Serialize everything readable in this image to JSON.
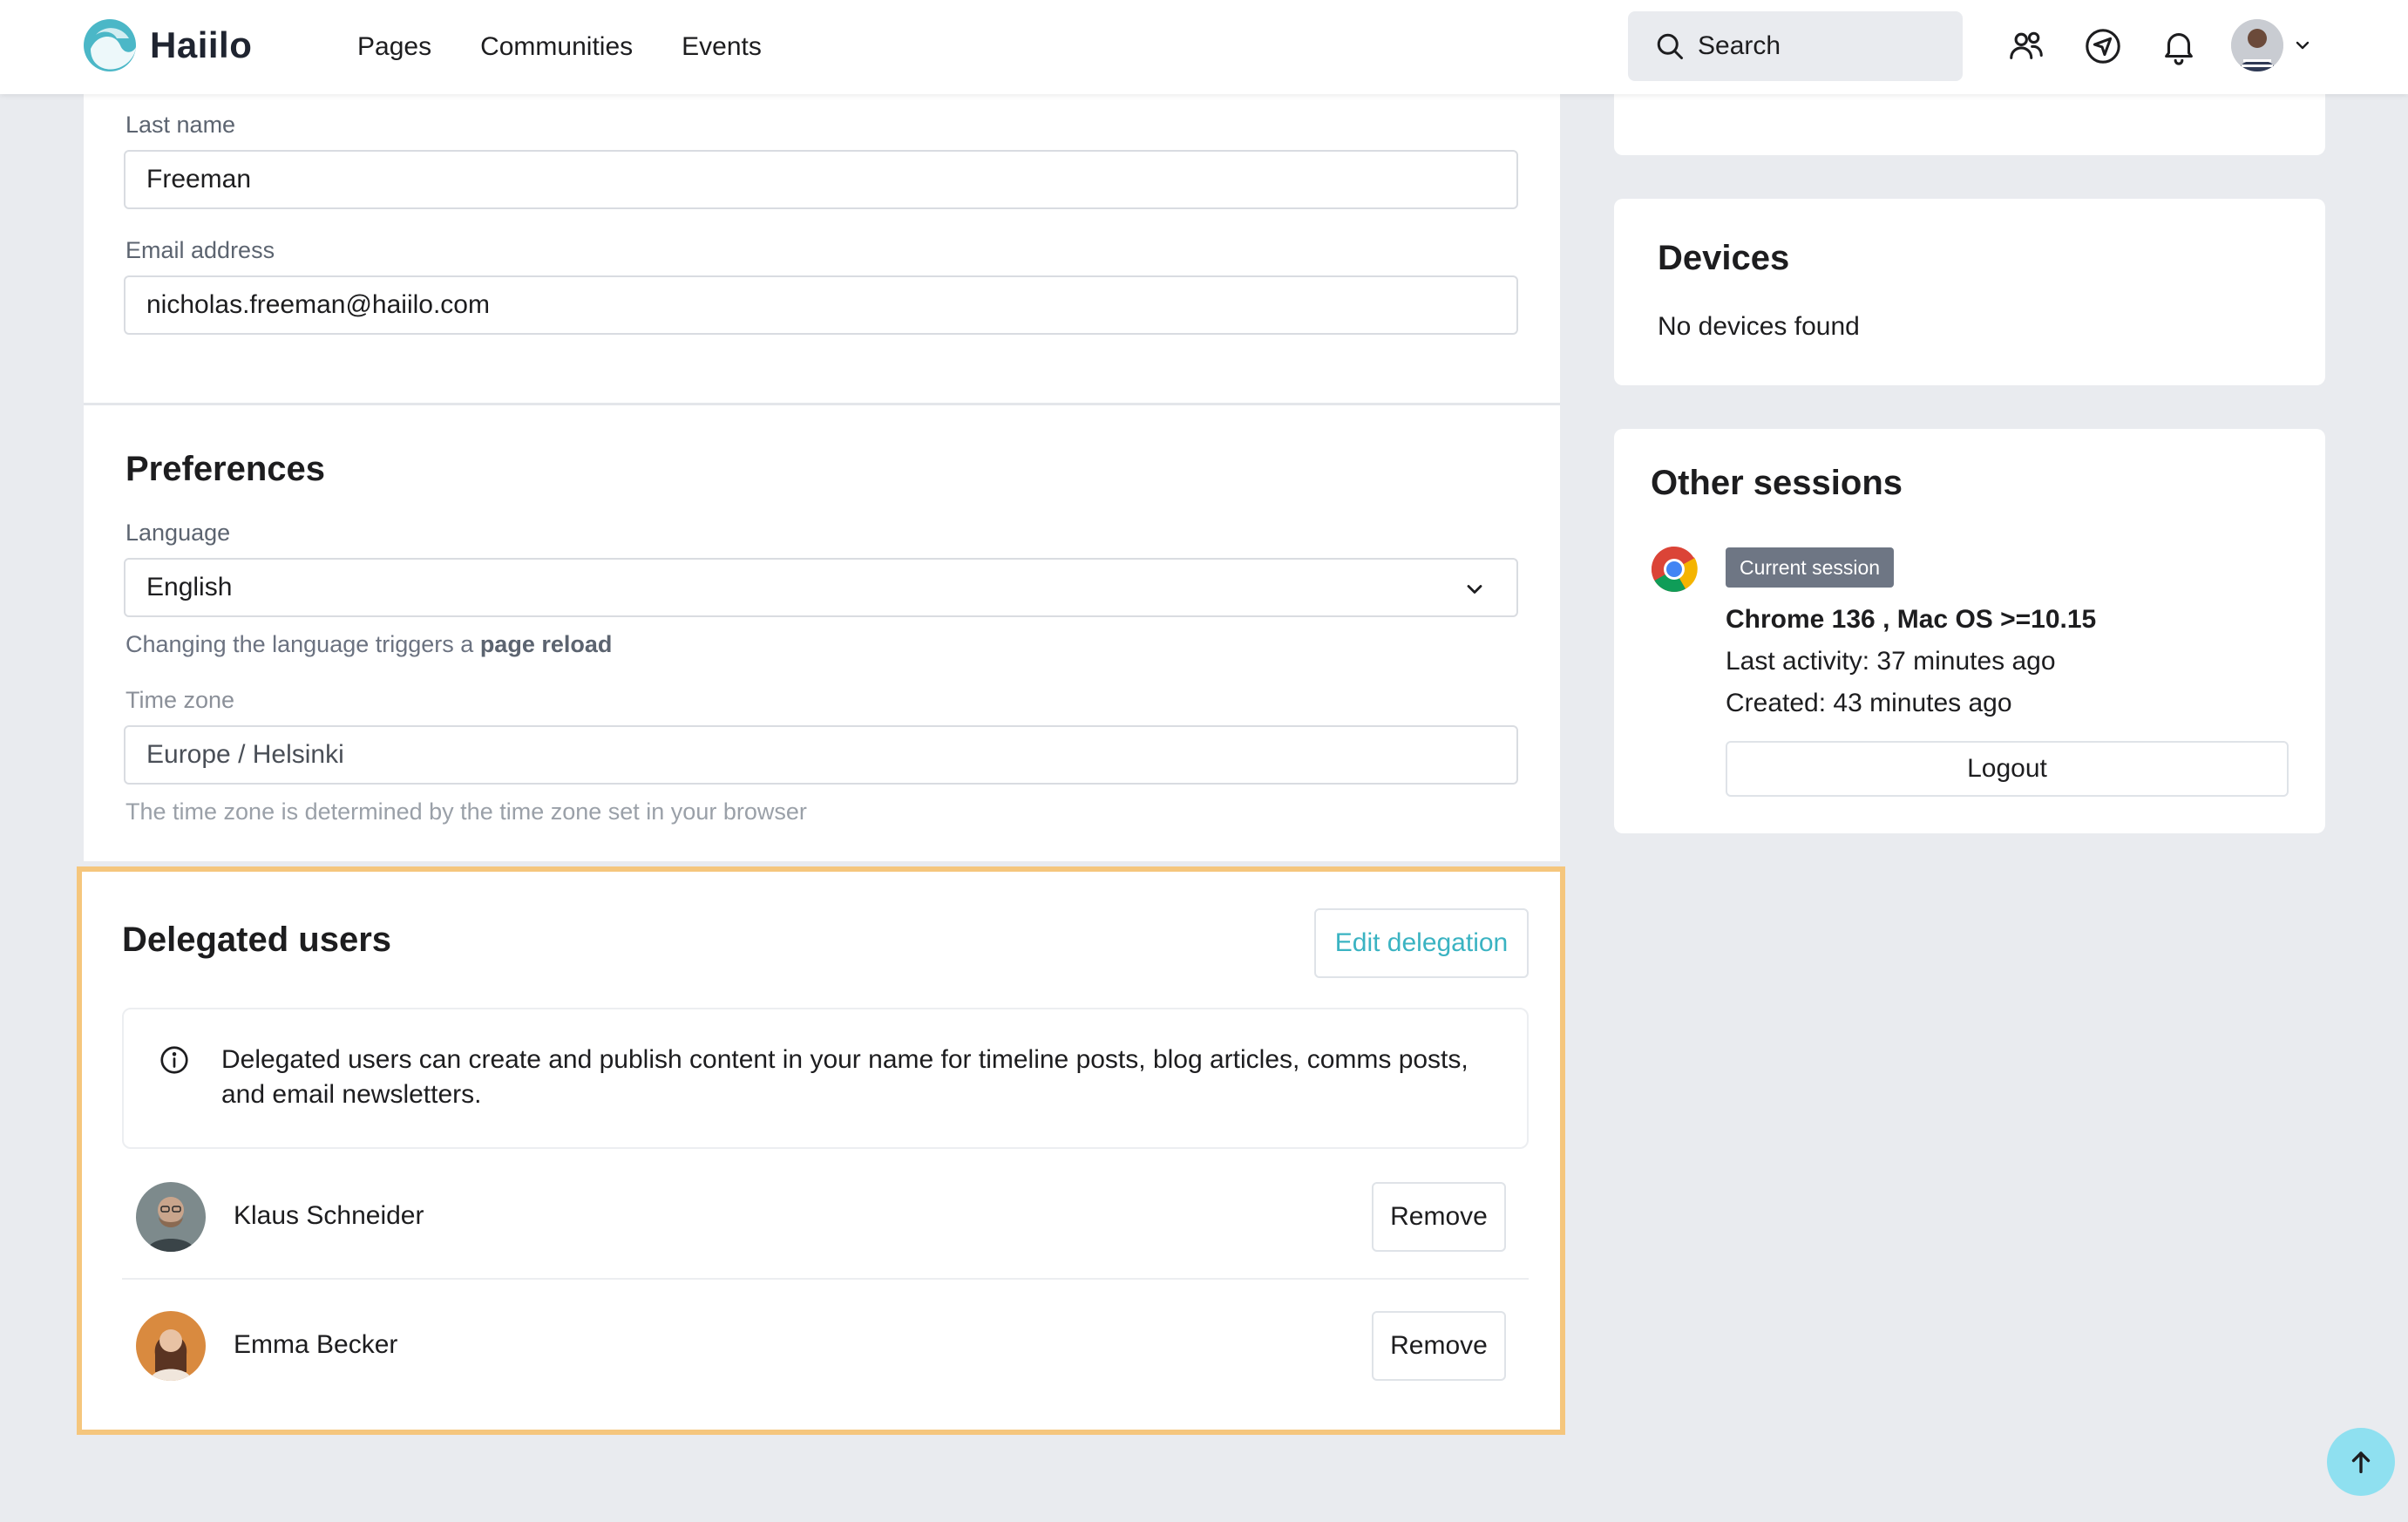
{
  "header": {
    "app_name": "Haiilo",
    "nav": [
      "Pages",
      "Communities",
      "Events"
    ],
    "search_placeholder": "Search",
    "icons": [
      "colleagues-icon",
      "navigator-icon",
      "bell-icon",
      "user-avatar",
      "chevron-down-icon"
    ]
  },
  "profile": {
    "last_name_label": "Last name",
    "last_name_value": "Freeman",
    "email_label": "Email address",
    "email_value": "nicholas.freeman@haiilo.com"
  },
  "preferences": {
    "title": "Preferences",
    "language_label": "Language",
    "language_value": "English",
    "language_help_prefix": "Changing the language triggers a",
    "language_help_bold": "page reload",
    "timezone_label": "Time zone",
    "timezone_value": "Europe / Helsinki",
    "timezone_help": "The time zone is determined by the time zone set in your browser"
  },
  "delegation": {
    "title": "Delegated users",
    "edit_label": "Edit delegation",
    "info": "Delegated users can create and publish content in your name for timeline posts, blog articles, comms posts, and email newsletters.",
    "users": [
      {
        "name": "Klaus Schneider",
        "action": "Remove"
      },
      {
        "name": "Emma Becker",
        "action": "Remove"
      }
    ]
  },
  "devices": {
    "title": "Devices",
    "empty": "No devices found"
  },
  "sessions": {
    "title": "Other sessions",
    "badge": "Current session",
    "browser": "Chrome 136 , Mac OS >=10.15",
    "last_activity": "Last activity: 37 minutes ago",
    "created": "Created: 43 minutes ago",
    "logout_label": "Logout"
  },
  "colors": {
    "accent": "#3ab3c2",
    "highlight_border": "#f5c67d",
    "badge_bg": "#6e7684",
    "scroll_top_bg": "#8fe0f0"
  }
}
